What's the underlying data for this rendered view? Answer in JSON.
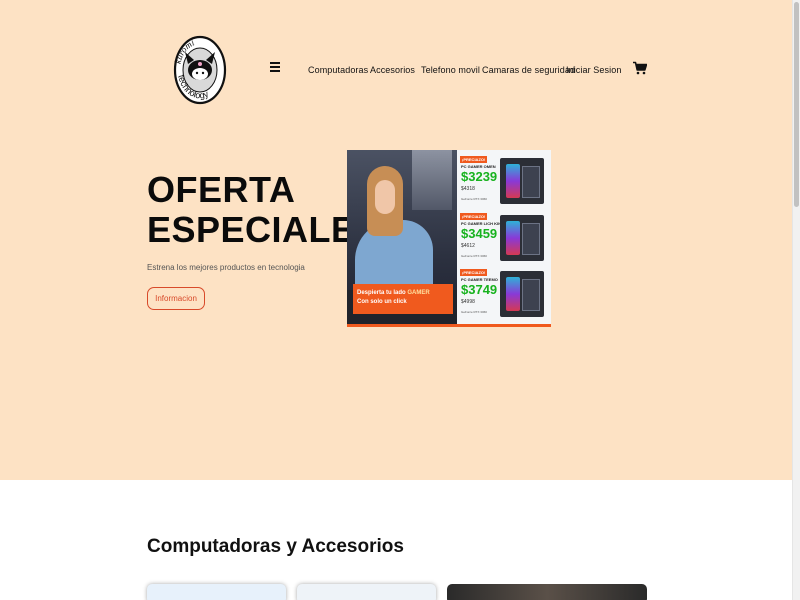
{
  "logo": {
    "line1": "kuromi",
    "line2": "technology"
  },
  "nav": {
    "items": [
      {
        "label": "Computadoras"
      },
      {
        "label": "Accesorios"
      },
      {
        "label": "Telefono movil"
      },
      {
        "label": "Camaras de seguridad"
      },
      {
        "label": "Iniciar Sesion"
      }
    ]
  },
  "hero": {
    "title_line1": "OFERTA",
    "title_line2": "ESPECIALES",
    "subtitle": "Estrena los mejores productos en tecnologia",
    "button_label": "Informacion"
  },
  "banner": {
    "offers": [
      {
        "tag": "¡PRECIAZO!",
        "name": "PC GAMER OMEN",
        "price": "$3239",
        "old": "$4318",
        "spec": "GeForce RTX 3060"
      },
      {
        "tag": "¡PRECIAZO!",
        "name": "PC GAMER LICH KING",
        "price": "$3459",
        "old": "$4612",
        "spec": "GeForce RTX 3060"
      },
      {
        "tag": "¡PRECIAZO!",
        "name": "PC GAMER TEEMO",
        "price": "$3749",
        "old": "$4998",
        "spec": "GeForce RTX 3060"
      }
    ],
    "cta_line1": "Despierta tu lado",
    "cta_accent": "GAMER",
    "cta_line2": "Con solo un click"
  },
  "section": {
    "title": "Computadoras y Accesorios"
  },
  "colors": {
    "hero_bg": "#fde2c4",
    "accent": "#d84a2a",
    "banner_orange": "#f05a1e",
    "price_green": "#17b21e"
  }
}
